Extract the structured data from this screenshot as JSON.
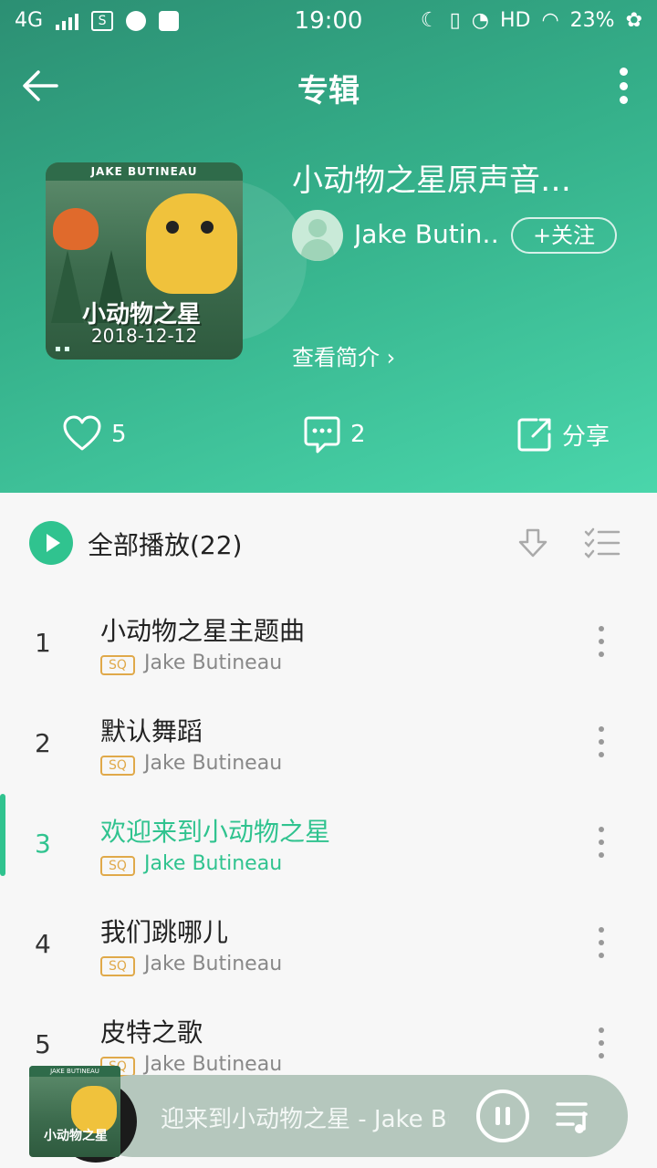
{
  "status": {
    "network": "4G",
    "time": "19:00",
    "hd": "HD",
    "battery": "23%"
  },
  "nav": {
    "title": "专辑"
  },
  "album": {
    "cover_header": "JAKE BUTINEAU",
    "cover_logo": "小动物之星",
    "release_date": "2018-12-12",
    "title": "小动物之星原声音…",
    "artist": "Jake Butin…",
    "follow_label": "+关注",
    "intro_label": "查看简介 ›"
  },
  "actions": {
    "likes": "5",
    "comments": "2",
    "share_label": "分享"
  },
  "list": {
    "play_all_label": "全部播放(22)",
    "tracks": [
      {
        "num": "1",
        "title": "小动物之星主题曲",
        "quality": "SQ",
        "artist": "Jake Butineau"
      },
      {
        "num": "2",
        "title": "默认舞蹈",
        "quality": "SQ",
        "artist": "Jake Butineau"
      },
      {
        "num": "3",
        "title": "欢迎来到小动物之星",
        "quality": "SQ",
        "artist": "Jake Butineau"
      },
      {
        "num": "4",
        "title": "我们跳哪儿",
        "quality": "SQ",
        "artist": "Jake Butineau"
      },
      {
        "num": "5",
        "title": "皮特之歌",
        "quality": "SQ",
        "artist": "Jake Butineau"
      }
    ]
  },
  "player": {
    "cover_header": "JAKE BUTINEAU",
    "cover_logo": "小动物之星",
    "now_playing": "迎来到小动物之星 - Jake Bu"
  },
  "colors": {
    "accent": "#30c38f",
    "header_start": "#2c8f73",
    "header_end": "#4ad6ab",
    "sq_badge": "#e0a94a"
  }
}
